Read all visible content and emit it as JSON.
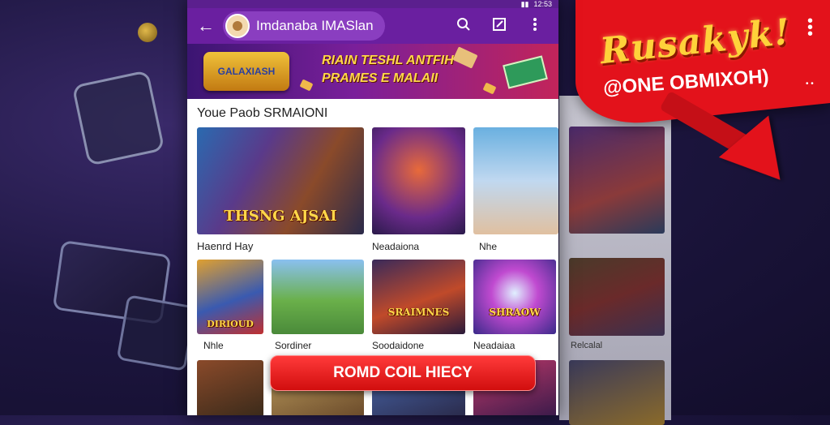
{
  "app": {
    "title": "Imdanaba IMASlan",
    "back_icon": "arrow-left-icon",
    "search_icon": "search-icon",
    "edit_icon": "edit-square-icon",
    "menu_icon": "more-vertical-icon",
    "status_time": "12:53"
  },
  "hero": {
    "logo_text": "GALAXIASH",
    "headline_line1": "RIAIN TESHL ANTFIH",
    "headline_line2": "PRAMES E MALAII"
  },
  "sections": [
    {
      "title": "Youe Paob SRMAIONI"
    },
    {
      "title": ""
    }
  ],
  "row1": [
    {
      "caption": "THSNG AJSAI",
      "label": "Haenrd Hay"
    },
    {
      "caption": "",
      "label": "Neadaiona"
    },
    {
      "caption": "",
      "label": "Nhe"
    }
  ],
  "row2": [
    {
      "caption": "DIRIOUD",
      "label": "Nhle"
    },
    {
      "caption": "",
      "label": "Sordiner"
    },
    {
      "caption": "SRAIMNES",
      "label": "Soodaidone"
    },
    {
      "caption": "SHRAOW",
      "label": "Neadaiaa"
    }
  ],
  "ghost_labels": [
    "Relcalal"
  ],
  "cta": {
    "label": "ROMD COIL HIECY"
  },
  "promo": {
    "title": "Rusakyk!",
    "subtitle": "@ONE OBMIXOH)"
  },
  "colors": {
    "appbar": "#6a1fa0",
    "cta": "#e3121b",
    "promo_bg": "#e3121b",
    "promo_title": "#ffd23a"
  }
}
